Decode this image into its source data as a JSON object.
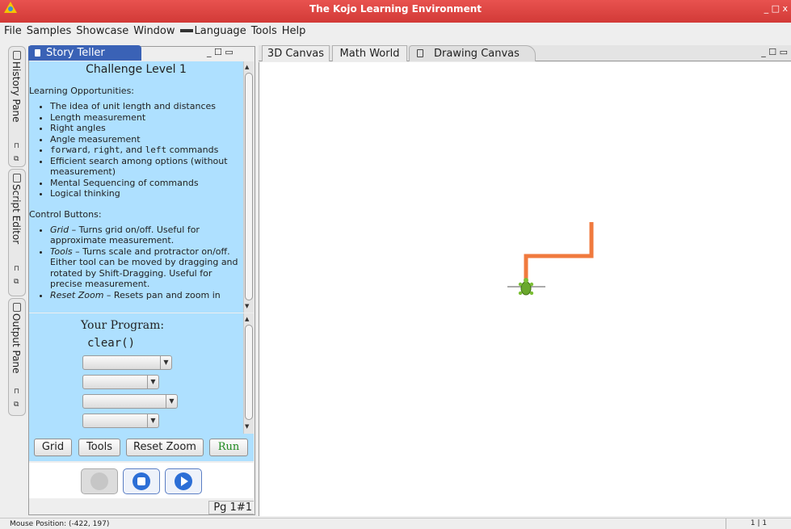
{
  "window": {
    "title": "The Kojo Learning Environment",
    "controls": "_ □ x"
  },
  "menubar": {
    "items": [
      "File",
      "Samples",
      "Showcase",
      "Window",
      "Language",
      "Tools",
      "Help"
    ]
  },
  "side_tabs": [
    "History Pane",
    "Script Editor",
    "Output Pane"
  ],
  "story": {
    "tab_label": "Story Teller",
    "panel_controls": "_ ☐ ▭",
    "heading": "Challenge Level 1",
    "section1": "Learning Opportunities:",
    "opps": [
      "The idea of unit length and distances",
      "Length measurement",
      "Right angles",
      "Angle measurement"
    ],
    "opp_cmd_1": "forward",
    "opp_cmd_2": "right",
    "opp_cmd_sep": ", ",
    "opp_cmd_and": ", and ",
    "opp_cmd_3": "left",
    "opp_cmd_tail": " commands",
    "opps2": [
      "Efficient search among options (without measurement)",
      "Mental Sequencing of commands",
      "Logical thinking"
    ],
    "section2": "Control Buttons:",
    "ctrl_grid_name": "Grid",
    "ctrl_grid_desc": " – Turns grid on/off. Useful for approximate measurement.",
    "ctrl_tools_name": "Tools",
    "ctrl_tools_desc": " – Turns scale and protractor on/off. Either tool can be moved by dragging and rotated by Shift-Dragging. Useful for precise measurement.",
    "ctrl_reset_name": "Reset Zoom",
    "ctrl_reset_desc": " – Resets pan and zoom in"
  },
  "program": {
    "title": "Your Program:",
    "code": "clear()"
  },
  "buttons": {
    "grid": "Grid",
    "tools": "Tools",
    "reset_zoom": "Reset Zoom",
    "run": "Run"
  },
  "page_indicator": "Pg 1#1",
  "canvas": {
    "tabs": [
      "3D Canvas",
      "Math World",
      "Drawing Canvas"
    ],
    "controls": "_ ☐ ▭",
    "path_color": "#f07a3e"
  },
  "status": {
    "mouse_position": "Mouse Position: (-422, 197)",
    "right": "1 | 1"
  }
}
